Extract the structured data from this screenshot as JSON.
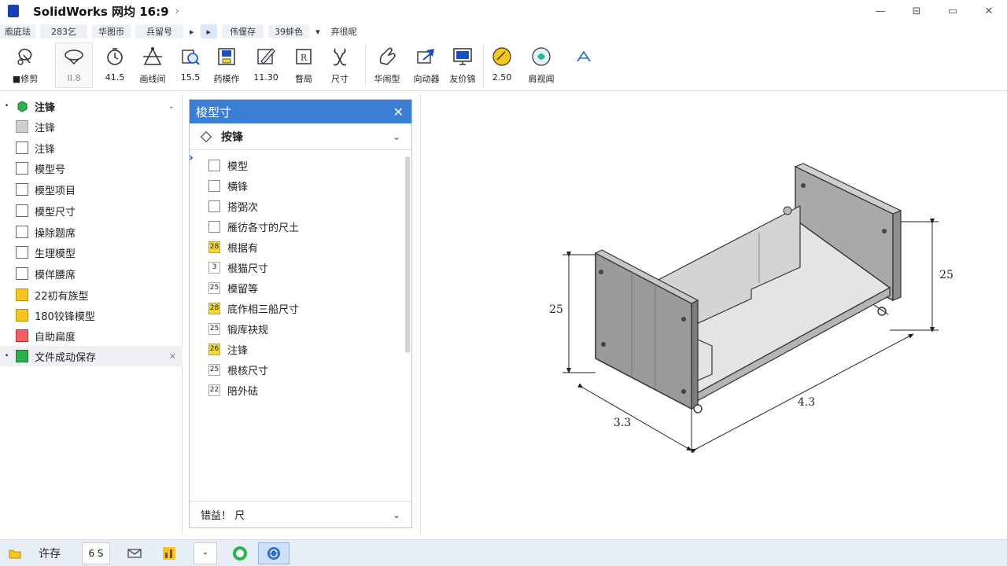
{
  "titlebar": {
    "title": "SolidWorks 网均  16:9",
    "chevron": "›",
    "minimize": "—",
    "restore": "⊟",
    "maximize": "▭",
    "close": "✕"
  },
  "menu": [
    "庖庛珐",
    "283乞",
    "华图帀",
    "兵留号",
    "▸",
    "▸",
    "伟偃存",
    "39蚌色",
    "▾",
    "弃很昵"
  ],
  "ribbon": {
    "tools": [
      {
        "label": "■修剪",
        "icon": "trim-icon"
      },
      {
        "label": "II.8",
        "icon": "sketch-shape-icon"
      },
      {
        "label": "41.5",
        "icon": "clock-icon"
      },
      {
        "label": "画线间",
        "icon": "line-icon"
      },
      {
        "label": "15.5",
        "icon": "zoom-icon"
      },
      {
        "label": "药模作",
        "icon": "save-icon"
      },
      {
        "label": "11.30",
        "icon": "edit-icon"
      },
      {
        "label": "瞀局",
        "icon": "reference-icon"
      },
      {
        "label": "尺寸",
        "icon": "dimension-icon"
      },
      {
        "label": "华闹型",
        "icon": "hand-icon"
      },
      {
        "label": "向动器",
        "icon": "move-icon"
      },
      {
        "label": "友价锦",
        "icon": "display-icon"
      },
      {
        "label": "2.50",
        "icon": "sun-icon"
      },
      {
        "label": "肩视闻",
        "icon": "view-icon"
      },
      {
        "label": "",
        "icon": "up-icon"
      }
    ]
  },
  "tree": {
    "items": [
      {
        "label": "注锋",
        "box": "green",
        "bullet": "•",
        "chevron": "⌄",
        "bold": true
      },
      {
        "label": "注锋",
        "box": "gray"
      },
      {
        "label": "注锋",
        "box": "white"
      },
      {
        "label": "模型号",
        "box": "white"
      },
      {
        "label": "模型项目",
        "box": "white"
      },
      {
        "label": "模型尺寸",
        "box": "white"
      },
      {
        "label": "操除题席",
        "box": "white"
      },
      {
        "label": "生理模型",
        "box": "white"
      },
      {
        "label": "模佯腰席",
        "box": "white"
      },
      {
        "label": "22初有族型",
        "box": "yellow"
      },
      {
        "label": "180铰锋模型",
        "box": "yellow"
      },
      {
        "label": "自助扁度",
        "box": "red"
      },
      {
        "label": "文件成动保存",
        "box": "green",
        "bullet": "•",
        "close": "✕",
        "selected": true
      }
    ]
  },
  "panel": {
    "title": "梭型寸",
    "close": "✕",
    "section": "按锋",
    "section_chevron": "⌄",
    "marker": "›",
    "items": [
      {
        "type": "box",
        "label": "模型"
      },
      {
        "type": "box",
        "label": "横锋"
      },
      {
        "type": "box",
        "label": "搭弼次"
      },
      {
        "type": "box",
        "label": "雁彷各寸的尺土"
      },
      {
        "type": "num",
        "num": "28",
        "yellow": true,
        "label": "根据有"
      },
      {
        "type": "num",
        "num": "3",
        "label": "根猫尺寸"
      },
      {
        "type": "num",
        "num": "25",
        "label": "模留等"
      },
      {
        "type": "num",
        "num": "28",
        "yellow": true,
        "label": "底作相三船尺寸"
      },
      {
        "type": "num",
        "num": "25",
        "label": "锻库袂规"
      },
      {
        "type": "num",
        "num": "26",
        "label": "注锋"
      },
      {
        "type": "num",
        "num": "25",
        "label": "根核尺寸"
      },
      {
        "type": "num",
        "num": "22",
        "label": "陪外砝"
      }
    ],
    "footer": "错益！ 尺",
    "footer_chevron": "⌄"
  },
  "model": {
    "dim_height_left": "25",
    "dim_height_right": "25",
    "dim_depth": "3.3",
    "dim_width": "4.3"
  },
  "taskbar": {
    "items": [
      {
        "label": "",
        "icon": "folder-icon"
      },
      {
        "label": "许存",
        "icon": ""
      },
      {
        "label": "6 S",
        "icon": ""
      },
      {
        "label": "",
        "icon": "envelope-icon"
      },
      {
        "label": "",
        "icon": "chart-icon"
      },
      {
        "label": "-",
        "icon": ""
      },
      {
        "label": "",
        "icon": "chat-icon"
      },
      {
        "label": "",
        "icon": "refresh-icon"
      }
    ]
  },
  "colors": {
    "accent": "#3a7fd4",
    "yellow": "#f6d83a",
    "green": "#2bb24c",
    "red": "#f06060"
  }
}
